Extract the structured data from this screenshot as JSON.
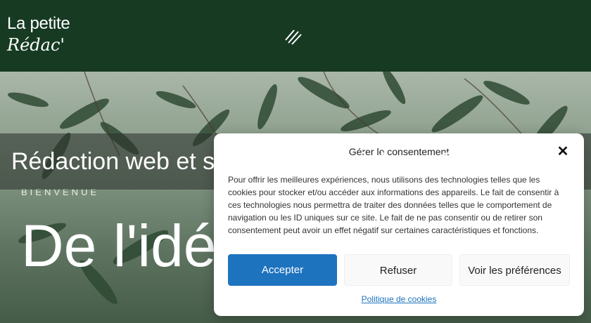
{
  "header": {
    "logo_line1": "La petite",
    "logo_line2": "Rédac'",
    "menu_icon": "hamburger-slash-icon",
    "background": "#173a23"
  },
  "page_title": "Rédaction web et stratégie éditoriale en Guadeloupe",
  "hero": {
    "welcome": "BIENVENUE",
    "title": "De l'idée au mot juste"
  },
  "cookie_modal": {
    "title": "Gérer le consentement",
    "close_icon": "close-icon",
    "text": "Pour offrir les meilleures expériences, nous utilisons des technologies telles que les cookies pour stocker et/ou accéder aux informations des appareils. Le fait de consentir à ces technologies nous permettra de traiter des données telles que le comportement de navigation ou les ID uniques sur ce site. Le fait de ne pas consentir ou de retirer son consentement peut avoir un effet négatif sur certaines caractéristiques et fonctions.",
    "accept_label": "Accepter",
    "refuse_label": "Refuser",
    "preferences_label": "Voir les préférences",
    "policy_link": "Politique de cookies",
    "accent": "#1e73be"
  }
}
